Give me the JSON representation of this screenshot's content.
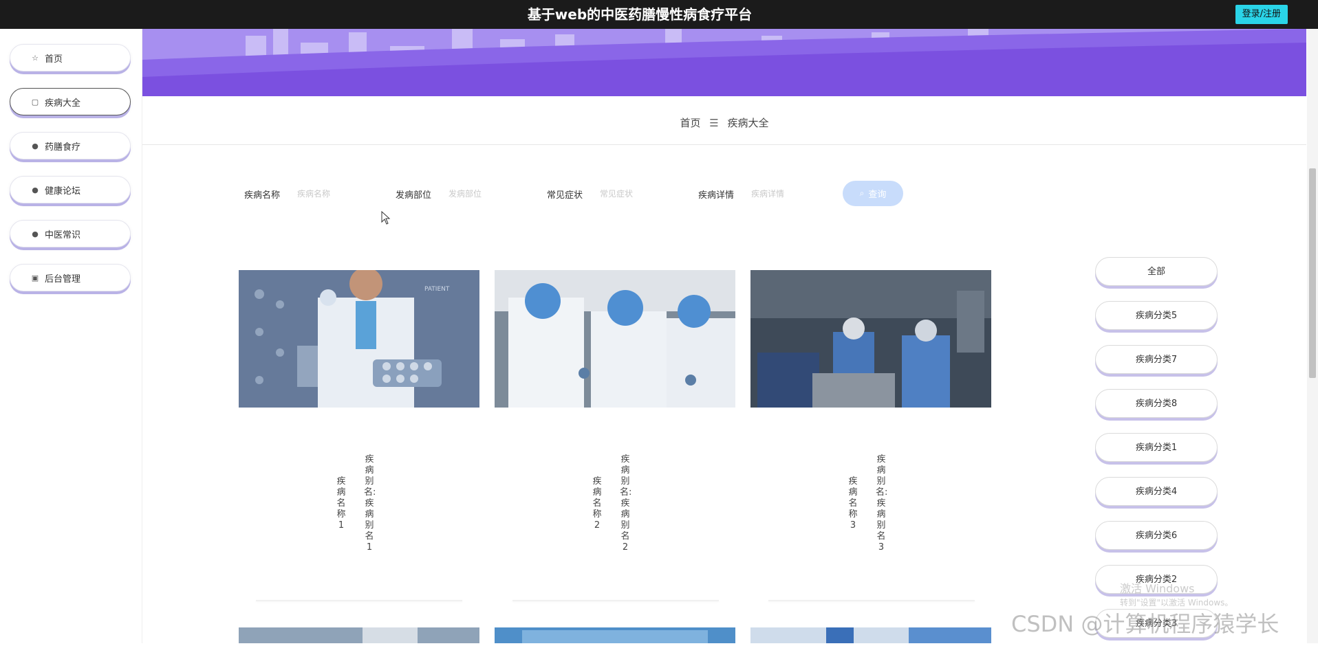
{
  "header": {
    "title": "基于web的中医药膳慢性病食疗平台",
    "login_label": "登录/注册"
  },
  "sidebar": {
    "items": [
      {
        "label": "首页",
        "icon": "star-icon"
      },
      {
        "label": "疾病大全",
        "icon": "bag-icon",
        "active": true
      },
      {
        "label": "药膳食疗",
        "icon": "info-icon"
      },
      {
        "label": "健康论坛",
        "icon": "question-icon"
      },
      {
        "label": "中医常识",
        "icon": "info-icon"
      },
      {
        "label": "后台管理",
        "icon": "briefcase-icon"
      }
    ]
  },
  "breadcrumb": {
    "home": "首页",
    "separator": "☰",
    "current": "疾病大全"
  },
  "search": {
    "fields": [
      {
        "label": "疾病名称",
        "placeholder": "疾病名称"
      },
      {
        "label": "发病部位",
        "placeholder": "发病部位"
      },
      {
        "label": "常见症状",
        "placeholder": "常见症状"
      },
      {
        "label": "疾病详情",
        "placeholder": "疾病详情"
      }
    ],
    "button_label": "查询"
  },
  "cards": [
    {
      "name": "疾病名称1",
      "alias": "疾病别名:疾病别名1"
    },
    {
      "name": "疾病名称2",
      "alias": "疾病别名:疾病别名2"
    },
    {
      "name": "疾病名称3",
      "alias": "疾病别名:疾病别名3"
    }
  ],
  "categories": [
    "全部",
    "疾病分类5",
    "疾病分类7",
    "疾病分类8",
    "疾病分类1",
    "疾病分类4",
    "疾病分类6",
    "疾病分类2",
    "疾病分类3"
  ],
  "watermarks": {
    "windows_line1": "激活 Windows",
    "windows_line2": "转到\"设置\"以激活 Windows。",
    "csdn": "CSDN @计算机程序猿学长"
  },
  "colors": {
    "banner": "#8e6fe6",
    "login_button": "#2ad4e8",
    "search_button": "#c8dcfb",
    "topbar": "#1b1b1b"
  }
}
